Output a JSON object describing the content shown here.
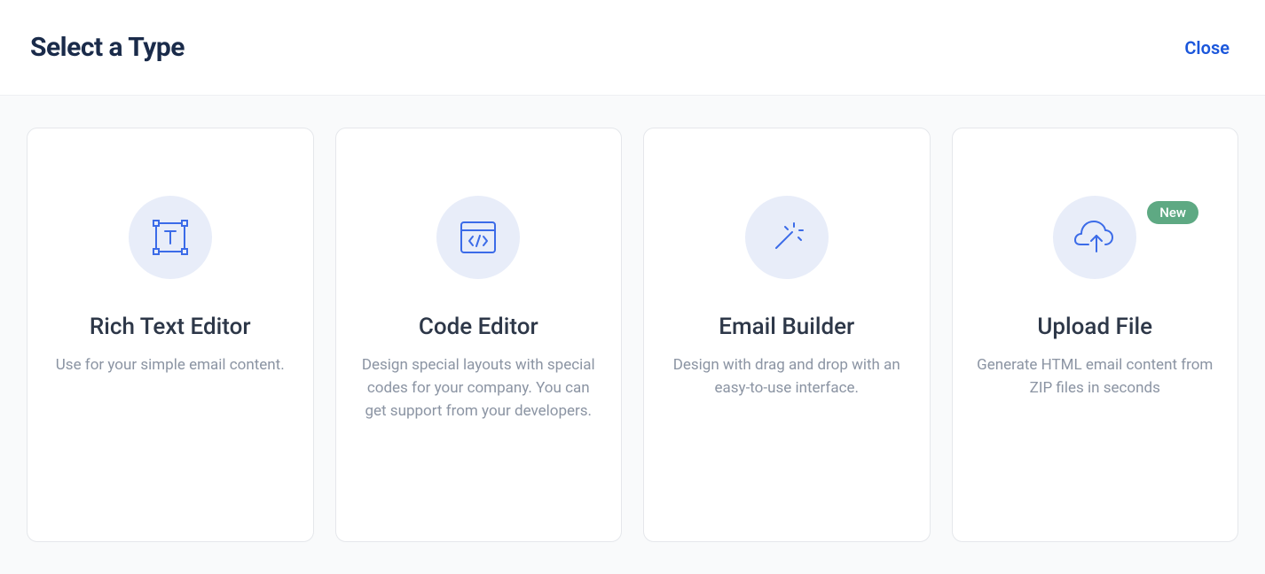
{
  "header": {
    "title": "Select a Type",
    "close_label": "Close"
  },
  "cards": [
    {
      "title": "Rich Text Editor",
      "desc": "Use for your simple email content.",
      "icon": "text-box-icon",
      "badge": null
    },
    {
      "title": "Code Editor",
      "desc": "Design special layouts with special codes for your company. You can get support from your developers.",
      "icon": "code-window-icon",
      "badge": null
    },
    {
      "title": "Email Builder",
      "desc": "Design with drag and drop with an easy-to-use interface.",
      "icon": "wand-icon",
      "badge": null
    },
    {
      "title": "Upload File",
      "desc": "Generate HTML email content from ZIP files in seconds",
      "icon": "cloud-upload-icon",
      "badge": "New"
    }
  ]
}
